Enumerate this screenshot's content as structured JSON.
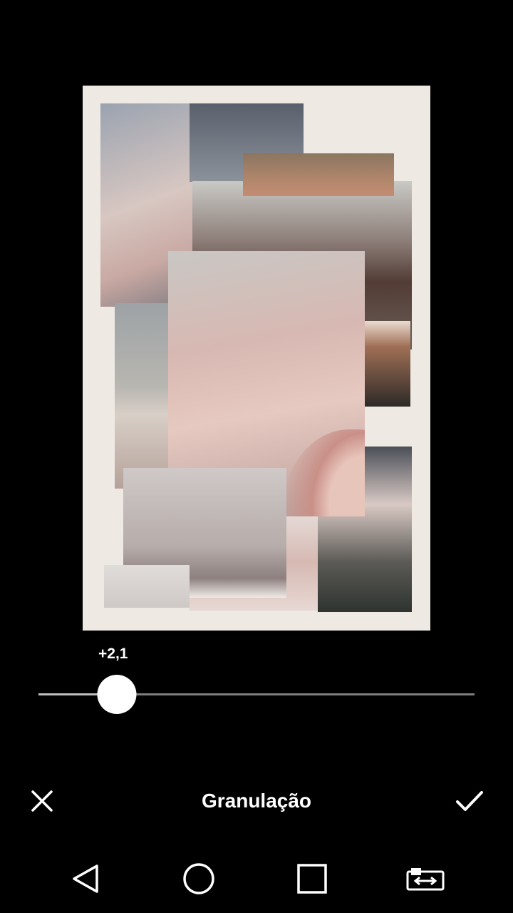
{
  "editor": {
    "tool_title": "Granulação",
    "value_label": "+2,1",
    "slider_value": 2.1,
    "slider_fraction": 0.18
  },
  "icons": {
    "cancel": "close-icon",
    "apply": "checkmark-icon",
    "back": "back-triangle-icon",
    "home": "home-circle-icon",
    "recent": "recent-apps-square-icon",
    "switch": "rotate-screen-icon"
  },
  "colors": {
    "background": "#000000",
    "text": "#ffffff",
    "track": "#7d7d7d",
    "thumb": "#ffffff"
  }
}
